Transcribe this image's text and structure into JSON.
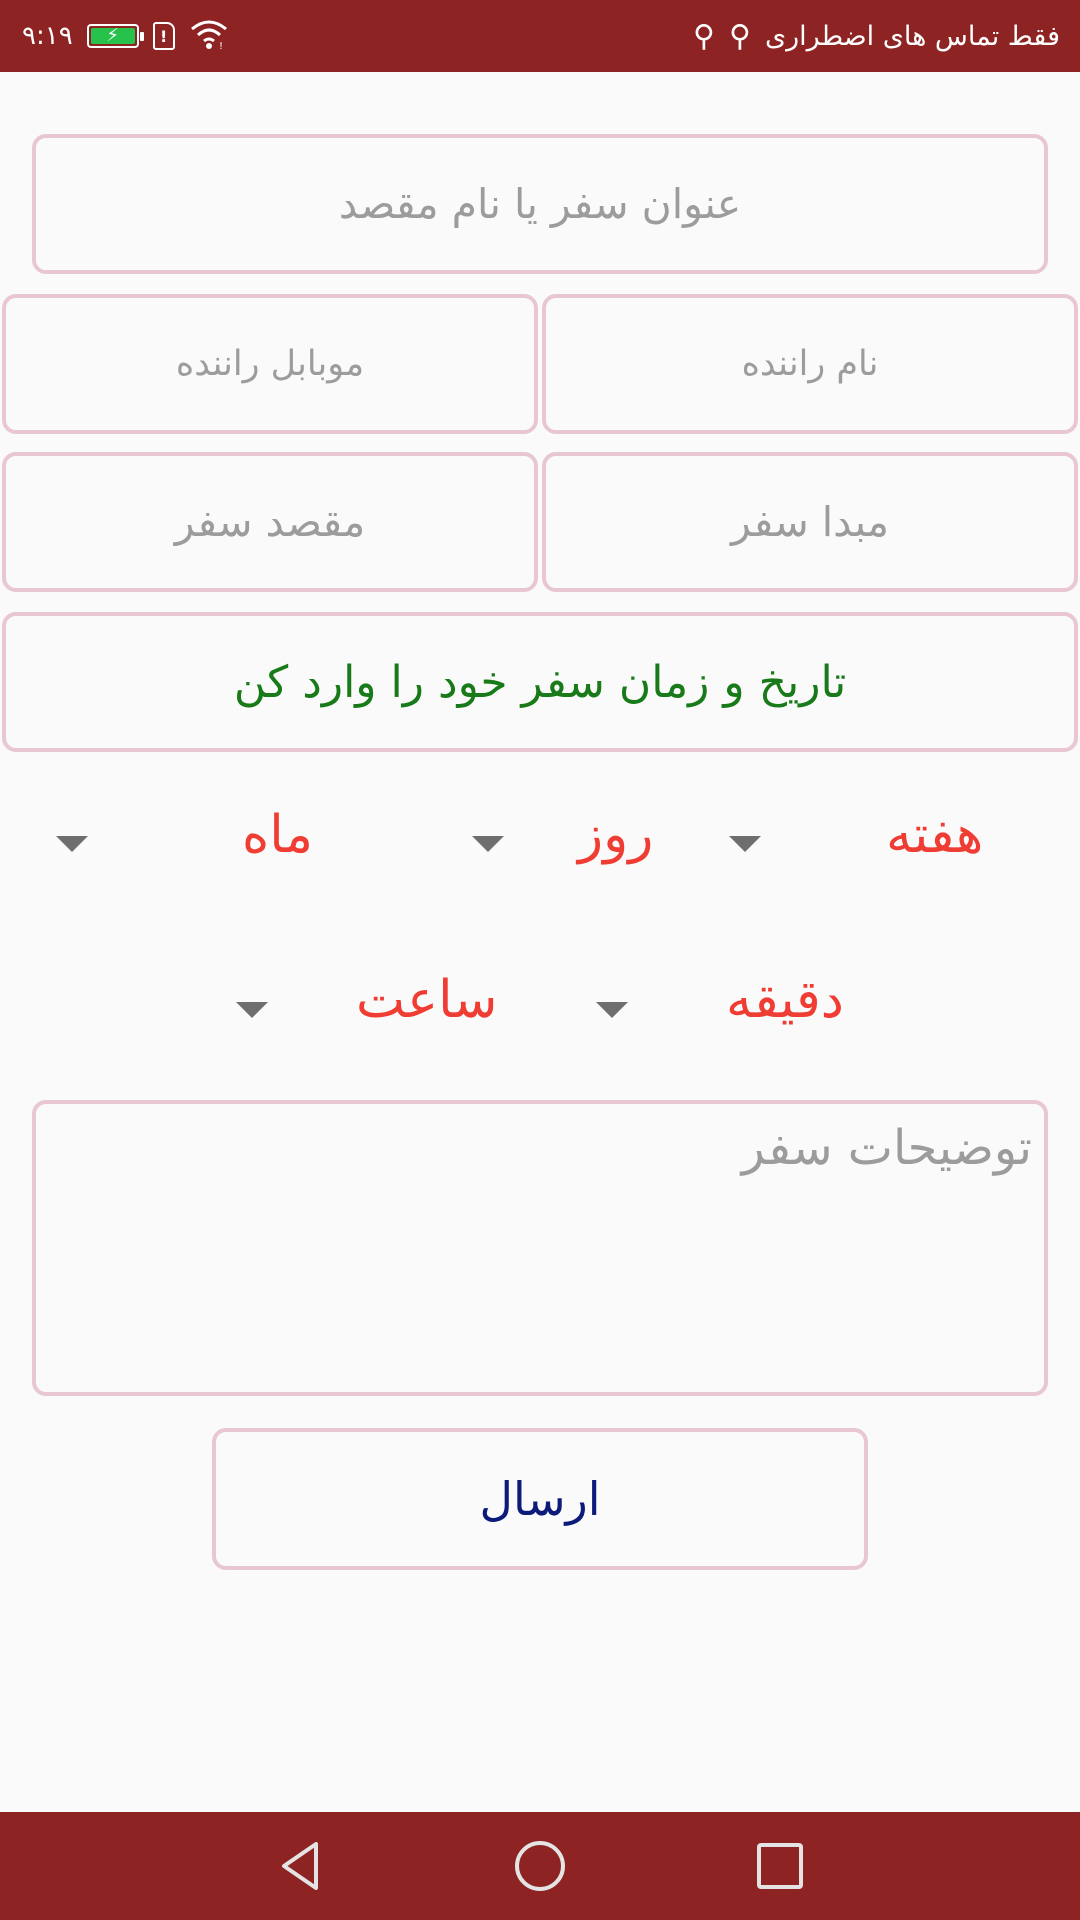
{
  "status_bar": {
    "time": "۹:۱۹",
    "carrier_text": "فقط تماس های اضطراری",
    "sim_alert": "!"
  },
  "form": {
    "title_placeholder": "عنوان سفر یا نام مقصد",
    "driver_name_placeholder": "نام راننده",
    "driver_mobile_placeholder": "موبابل راننده",
    "origin_placeholder": "مبدا سفر",
    "destination_placeholder": "مقصد سفر",
    "date_time_prompt": "تاریخ و زمان سفر خود را وارد کن",
    "spinners": {
      "week": "هفته",
      "day": "روز",
      "month": "ماه",
      "minute": "دقیقه",
      "hour": "ساعت"
    },
    "notes_placeholder": "توضیحات سفر",
    "send_label": "ارسال"
  },
  "colors": {
    "primary": "#8e2323",
    "field_border": "#e8c7d2",
    "spinner_text": "#ef3d34",
    "date_prompt": "#187a18",
    "send_text": "#0c1a7a"
  }
}
